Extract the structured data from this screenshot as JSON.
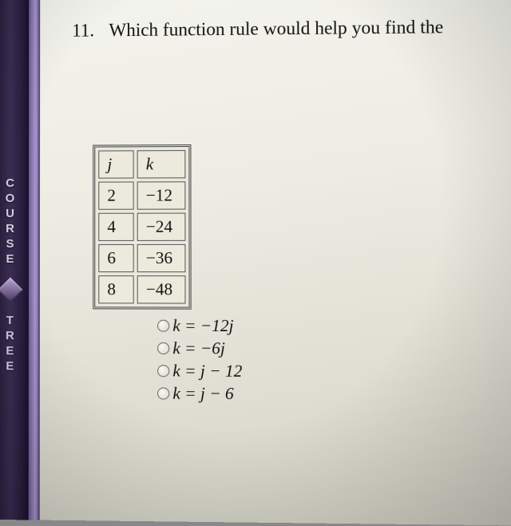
{
  "rail": {
    "word1": "COURSE",
    "word2": "TREE"
  },
  "question": {
    "number": "11.",
    "text": "Which function rule would help you find the"
  },
  "chart_data": {
    "type": "table",
    "columns": [
      "j",
      "k"
    ],
    "rows": [
      {
        "j": "2",
        "k": "−12"
      },
      {
        "j": "4",
        "k": "−24"
      },
      {
        "j": "6",
        "k": "−36"
      },
      {
        "j": "8",
        "k": "−48"
      }
    ]
  },
  "choices": {
    "a": "k = −12j",
    "b": "k = −6j",
    "c": "k = j − 12",
    "d": "k = j − 6"
  }
}
